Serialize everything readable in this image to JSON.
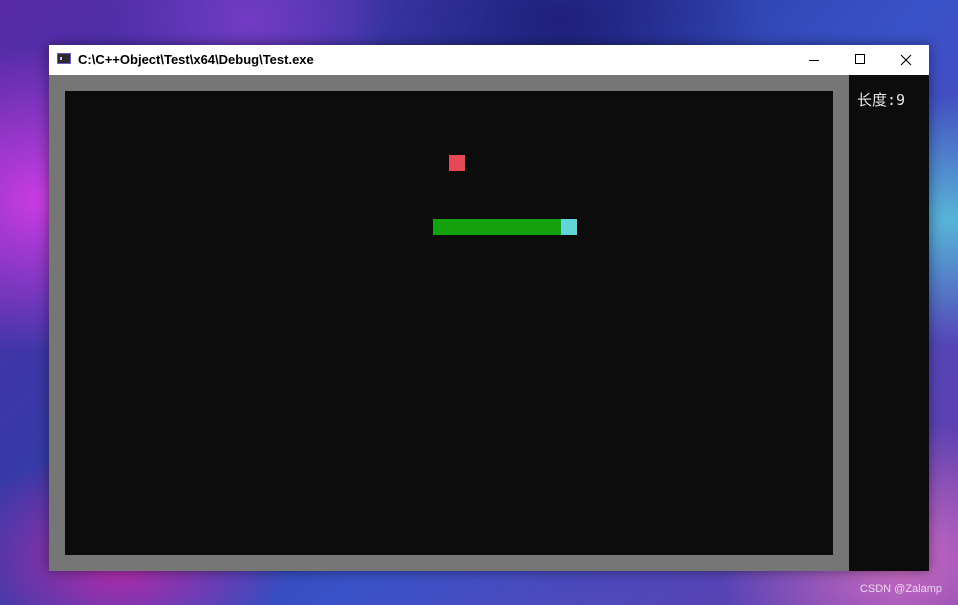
{
  "window": {
    "title": "C:\\C++Object\\Test\\x64\\Debug\\Test.exe"
  },
  "game": {
    "grid": {
      "cols": 48,
      "rows": 29,
      "cell_size": 16
    },
    "length_text": "长度:9",
    "food": {
      "col": 24,
      "row": 4,
      "color": "#e74856"
    },
    "snake": {
      "head": {
        "col": 31,
        "row": 8
      },
      "body": [
        {
          "col": 23,
          "row": 8
        },
        {
          "col": 24,
          "row": 8
        },
        {
          "col": 25,
          "row": 8
        },
        {
          "col": 26,
          "row": 8
        },
        {
          "col": 27,
          "row": 8
        },
        {
          "col": 28,
          "row": 8
        },
        {
          "col": 29,
          "row": 8
        },
        {
          "col": 30,
          "row": 8
        }
      ],
      "head_color": "#61d6d6",
      "body_color": "#13a10e"
    },
    "colors": {
      "frame": "#767676",
      "background": "#0c0c0c"
    }
  },
  "watermark": "CSDN @Zalamp"
}
